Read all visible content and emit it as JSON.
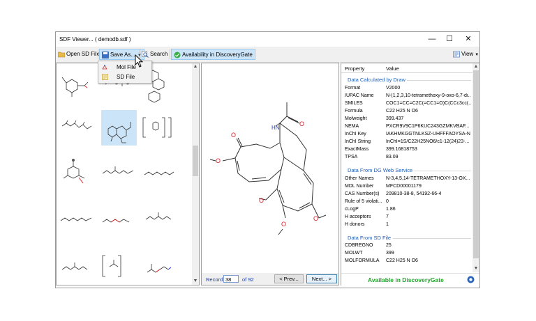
{
  "window": {
    "title": "SDF Viewer... ( demodb.sdf )",
    "controls": {
      "minimize": "—",
      "maximize": "☐",
      "close": "✕"
    }
  },
  "toolbar": {
    "open_label": "Open SD File",
    "save_label": "Save As...",
    "search_label": "Search",
    "availability_label": "Availability in DiscoveryGate",
    "view_label": "View"
  },
  "save_menu": {
    "items": [
      {
        "label": "Mol File"
      },
      {
        "label": "SD File"
      }
    ]
  },
  "record_nav": {
    "record_label": "Record",
    "record_value": "38",
    "of_label": "of 92",
    "prev_label": "< Prev...",
    "next_label": "Next... >"
  },
  "molecule_labels": {
    "oxygen": "O",
    "nh": "HN"
  },
  "properties": {
    "header": {
      "property": "Property",
      "value": "Value"
    },
    "sections": [
      {
        "title": "Data Calculated by Draw",
        "rows": [
          {
            "key": "Format",
            "value": "V2000"
          },
          {
            "key": "IUPAC Name",
            "value": "N-(1,2,3,10-tetramethoxy-9-oxo-6,7-di..."
          },
          {
            "key": "SMILES",
            "value": "COC1=CC=C2C(=CC1=O)C(CCc3cc(..."
          },
          {
            "key": "Formula",
            "value": "C22 H25 N O6"
          },
          {
            "key": "Molweight",
            "value": "399.437"
          },
          {
            "key": "NEMA",
            "value": "PXCR9V9C1P6KUC243GZMKVBAF..."
          },
          {
            "key": "InChI Key",
            "value": "IAKHMKGGTNLKSZ-UHFFFAOYSA-N"
          },
          {
            "key": "InChI String",
            "value": "InChI=1S/C22H25NO6/c1-12(24)23-..."
          },
          {
            "key": "ExactMass",
            "value": "399.16818753"
          },
          {
            "key": "TPSA",
            "value": "83.09"
          }
        ]
      },
      {
        "title": "Data From DG Web Service",
        "rows": [
          {
            "key": "Other Names",
            "value": "N-3,4,5,14-TETRAMETHOXY-13-OX..."
          },
          {
            "key": "MDL Number",
            "value": "MFCD00001179"
          },
          {
            "key": "CAS Number(s)",
            "value": "209810-38-8, 54192-66-4"
          },
          {
            "key": "Rule of 5 violati...",
            "value": "0"
          },
          {
            "key": "cLogP",
            "value": "1.86"
          },
          {
            "key": "H acceptors",
            "value": "7"
          },
          {
            "key": "H donors",
            "value": "1"
          }
        ]
      },
      {
        "title": "Data From SD File",
        "rows": [
          {
            "key": "CDBREGNO",
            "value": "25"
          },
          {
            "key": "MOLWT",
            "value": "399"
          },
          {
            "key": "MOLFORMULA",
            "value": "C22 H25 N O6"
          }
        ]
      }
    ]
  },
  "availability": {
    "status": "Available in DiscoveryGate",
    "color": "#22a32b"
  },
  "colors": {
    "accent": "#1f5db5",
    "selection": "#cce4f7"
  }
}
